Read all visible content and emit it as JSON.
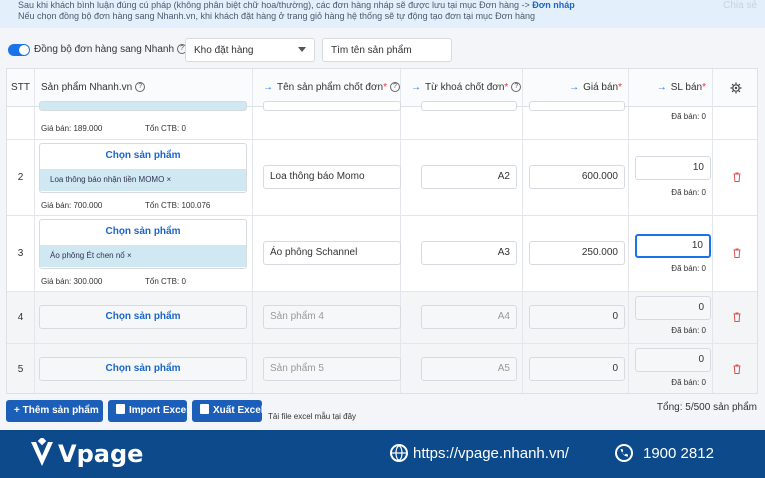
{
  "info": {
    "line1": "Sau khi khách bình luận đúng cú pháp (không phân biệt chữ hoa/thường), các đơn hàng nháp sẽ được lưu tại mục Đơn hàng -> ",
    "line1_link": "Đơn nháp",
    "line2": "Nếu chọn đồng bộ đơn hàng sang Nhanh.vn, khi khách đặt hàng ở trang giỏ hàng hệ thống sẽ tự động tạo đơn tại mục Đơn hàng",
    "corner": "Chia sẻ"
  },
  "toolbar": {
    "sync_label": "Đồng bộ đơn hàng sang Nhanh",
    "help": "?",
    "warehouse_value": "Kho đặt hàng",
    "search_value": "Tìm tên sản phẩm"
  },
  "table": {
    "headers": {
      "stt": "STT",
      "product": "Sản phẩm Nhanh.vn",
      "name": "Tên sản phẩm chốt đơn",
      "keyword": "Từ khoá chốt đơn",
      "price": "Giá bán",
      "qty": "SL bán",
      "required_mark": "*"
    },
    "choose_label": "Chọn sản phẩm",
    "price_prefix": "Giá bán:",
    "stock_prefix": "Tổn CTB:",
    "sold_prefix": "Đã bán:",
    "partial_row": {
      "price": "Giá bán: 189.000",
      "stock": "Tổn CTB: 0",
      "sold": "Đã bán: 0"
    },
    "rows": [
      {
        "stt": "2",
        "chip": "Loa thông báo nhận tiền MOMO ×",
        "price_meta": "Giá bán: 700.000",
        "stock_meta": "Tổn CTB: 100.076",
        "name": "Loa thông báo Momo",
        "keyword": "A2",
        "price": "600.000",
        "qty": "10",
        "sold": "Đã bán: 0"
      },
      {
        "stt": "3",
        "chip": "Áo phông Ét chen nổ ×",
        "price_meta": "Giá bán: 300.000",
        "stock_meta": "Tổn CTB: 0",
        "name": "Áo phông Schannel",
        "keyword": "A3",
        "price": "250.000",
        "qty": "10",
        "sold": "Đã bán: 0"
      },
      {
        "stt": "4",
        "name_placeholder": "Sản phẩm 4",
        "keyword": "A4",
        "price": "0",
        "qty": "0",
        "sold": "Đã bán: 0"
      },
      {
        "stt": "5",
        "name_placeholder": "Sản phẩm 5",
        "keyword": "A5",
        "price": "0",
        "qty": "0",
        "sold": "Đã bán: 0"
      }
    ]
  },
  "actions": {
    "add": "+ Thêm sản phẩm",
    "import": "Import Excel",
    "export": "Xuất Excel",
    "template": "Tải file excel mẫu tại đây",
    "total": "Tổng: 5/500 sản phẩm"
  },
  "footer": {
    "brand": "Vpage",
    "website": "https://vpage.nhanh.vn/",
    "phone": "1900 2812"
  },
  "colors": {
    "accent": "#1a73e8",
    "footer": "#0c4a8c",
    "chip": "#cfe8f1",
    "trash": "#d9534f"
  }
}
